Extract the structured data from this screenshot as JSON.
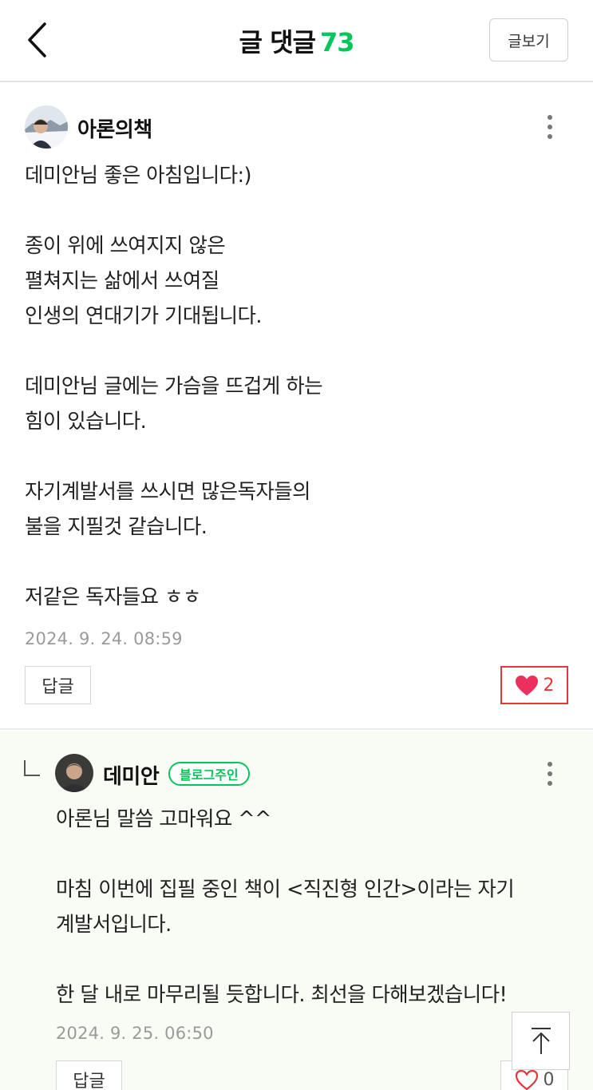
{
  "header": {
    "title": "글 댓글",
    "count": "73",
    "view_post_label": "글보기"
  },
  "comments": [
    {
      "author": "아론의책",
      "text": "데미안님 좋은 아침입니다:)\n\n종이 위에 쓰여지지 않은\n펼쳐지는 삶에서 쓰여질\n인생의 연대기가 기대됩니다.\n\n데미안님 글에는 가슴을 뜨겁게 하는\n힘이 있습니다.\n\n자기계발서를 쓰시면 많은독자들의\n불을 지필것 같습니다.\n\n저같은 독자들요 ㅎㅎ",
      "timestamp": "2024. 9. 24. 08:59",
      "reply_label": "답글",
      "likes": "2",
      "liked": true
    },
    {
      "author": "데미안",
      "badge": "블로그주인",
      "text": "아론님 말씀 고마워요 ^^\n\n마침 이번에 집필 중인 책이 <직진형 인간>이라는 자기\n계발서입니다.\n\n한 달 내로 마무리될 듯합니다. 최선을 다해보겠습니다!",
      "timestamp": "2024. 9. 25. 06:50",
      "reply_label": "답글",
      "likes": "0",
      "liked": false
    }
  ],
  "colors": {
    "accent": "#03c75a",
    "like_active": "#e5363b",
    "reply_background": "#f9fbf5"
  }
}
